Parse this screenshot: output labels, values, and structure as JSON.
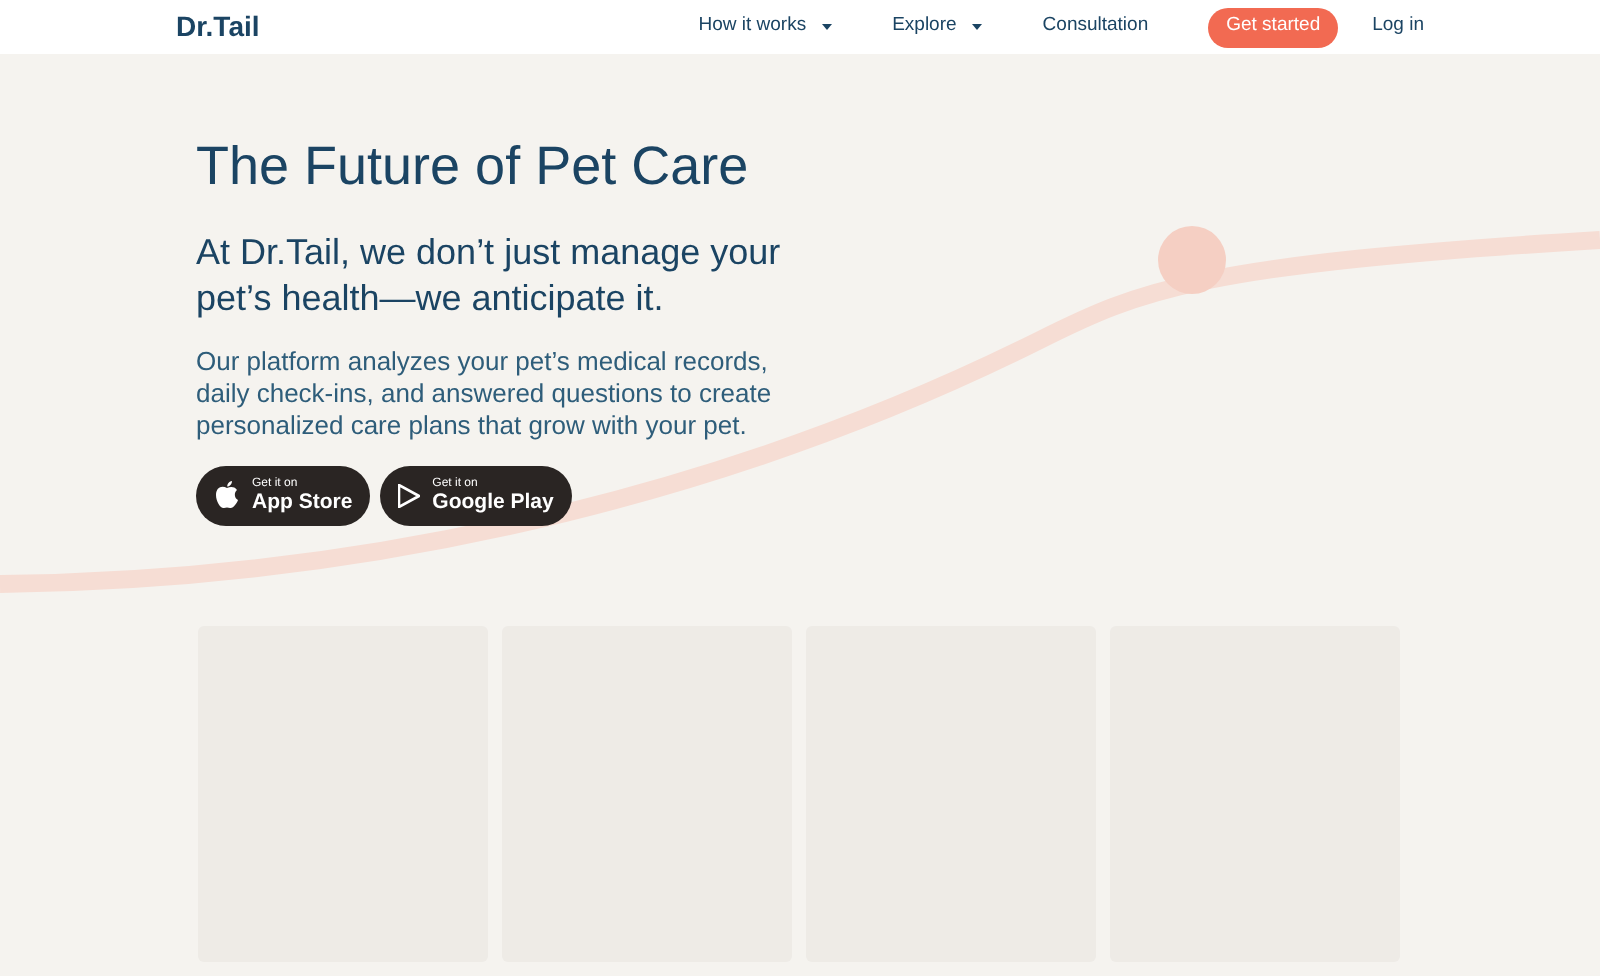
{
  "header": {
    "logo": "Dr.Tail",
    "nav": [
      {
        "label": "How it works",
        "dropdown": true
      },
      {
        "label": "Explore",
        "dropdown": true
      },
      {
        "label": "Consultation",
        "dropdown": false
      }
    ],
    "cta": "Get started",
    "login": "Log in"
  },
  "hero": {
    "title": "The Future of Pet Care",
    "subtitle": "At Dr.Tail, we don’t just manage your pet’s health—we anticipate it.",
    "description": "Our platform analyzes your pet’s medical records, daily check-ins, and answered questions to create personalized care plans that grow with your pet.",
    "store_buttons": [
      {
        "kind": "apple",
        "small": "Get it on",
        "label": "App Store"
      },
      {
        "kind": "google",
        "small": "Get it on",
        "label": "Google Play"
      }
    ]
  }
}
